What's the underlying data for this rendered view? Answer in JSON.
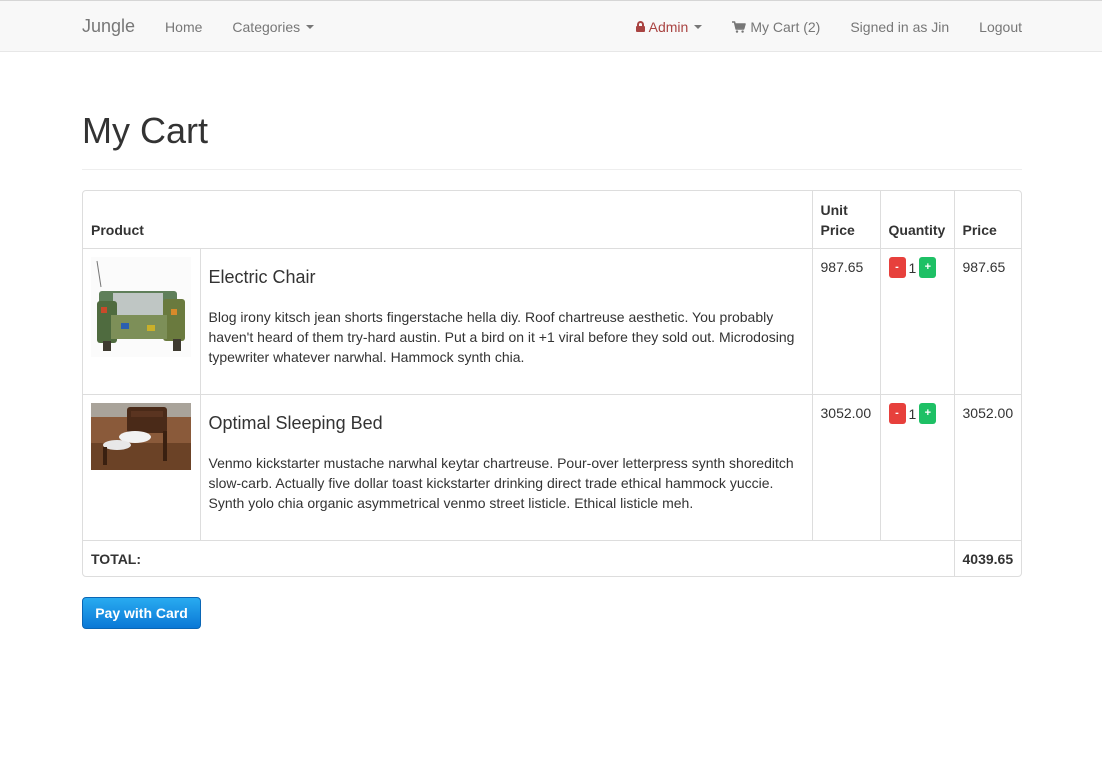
{
  "navbar": {
    "brand": "Jungle",
    "home": "Home",
    "categories": "Categories",
    "admin": "Admin",
    "cart": "My Cart (2)",
    "signed_in": "Signed in as Jin",
    "logout": "Logout"
  },
  "page": {
    "title": "My Cart"
  },
  "table": {
    "headers": {
      "product": "Product",
      "unit_price": "Unit Price",
      "quantity": "Quantity",
      "price": "Price"
    },
    "items": [
      {
        "name": "Electric Chair",
        "description": "Blog irony kitsch jean shorts fingerstache hella diy. Roof chartreuse aesthetic. You probably haven't heard of them try-hard austin. Put a bird on it +1 viral before they sold out. Microdosing typewriter whatever narwhal. Hammock synth chia.",
        "unit_price": "987.65",
        "quantity": "1",
        "price": "987.65",
        "minus_label": "-",
        "plus_label": "+"
      },
      {
        "name": "Optimal Sleeping Bed",
        "description": "Venmo kickstarter mustache narwhal keytar chartreuse. Pour-over letterpress synth shoreditch slow-carb. Actually five dollar toast kickstarter drinking direct trade ethical hammock yuccie. Synth yolo chia organic asymmetrical venmo street listicle. Ethical listicle meh.",
        "unit_price": "3052.00",
        "quantity": "1",
        "price": "3052.00",
        "minus_label": "-",
        "plus_label": "+"
      }
    ],
    "total_label": "TOTAL:",
    "total_value": "4039.65"
  },
  "checkout": {
    "pay_label": "Pay with Card"
  },
  "colors": {
    "navbar_bg": "#f8f8f8",
    "admin_red": "#a94442",
    "minus_red": "#e7403c",
    "plus_green": "#1ec065",
    "pay_blue": "#0a78d6"
  },
  "icons": {
    "admin": "lock-icon",
    "cart": "shopping-cart-icon",
    "dropdown": "caret-down-icon"
  }
}
